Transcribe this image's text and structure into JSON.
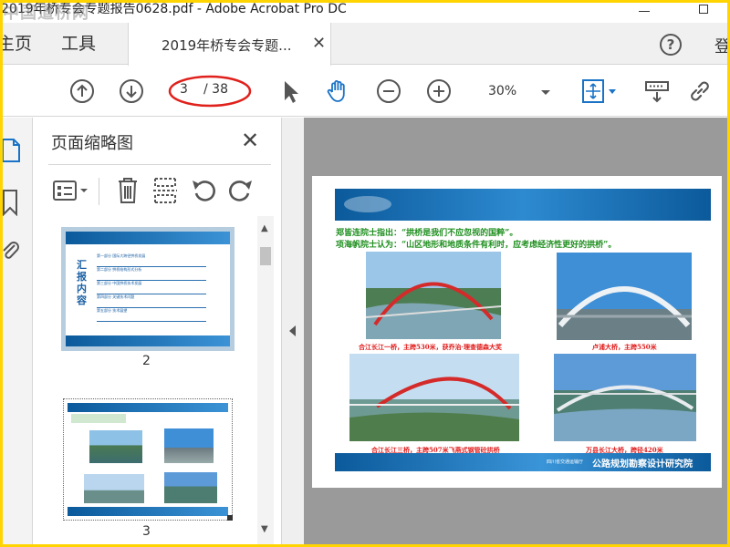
{
  "window": {
    "title": "2019年桥专会专题报告0628.pdf - Adobe Acrobat Pro DC",
    "watermark": "中国道桥网"
  },
  "tabs": {
    "home": "主页",
    "tools": "工具",
    "document": "2019年桥专会专题...",
    "login": "登"
  },
  "toolbar": {
    "current_page": "3",
    "total_pages": "/ 38",
    "zoom": "30%",
    "icons": [
      "prev-page-icon",
      "next-page-icon",
      "select-cursor-icon",
      "hand-tool-icon",
      "zoom-out-icon",
      "zoom-in-icon",
      "fit-page-icon",
      "read-mode-icon",
      "share-link-icon"
    ]
  },
  "thumb_panel": {
    "title": "页面缩略图",
    "thumbnails": [
      {
        "page_label": "2"
      },
      {
        "page_label": "3"
      }
    ]
  },
  "slide_p2": {
    "vertical_title": "汇报内容",
    "items": [
      "第一部分  国际大跨径拱桥发展",
      "第二部分  拱桥结构形式分析",
      "第三部分  中国拱桥技术发展",
      "第四部分  关键技术问题",
      "第五部分  技术展望"
    ]
  },
  "slide": {
    "quote1": "郑皆连院士指出：“拱桥是我们不应忽视的国粹”。",
    "quote2": "项海帆院士认为：“山区地形和地质条件有利时，应考虑经济性更好的拱桥”。",
    "captions": [
      "合江长江一桥，主跨530米，获乔治·理查德森大奖",
      "卢浦大桥，主跨550米",
      "合江长江三桥，主跨507米飞燕式钢管砼拱桥",
      "万县长江大桥，跨径420米"
    ],
    "footer_text": "公路规划勘察设计研究院",
    "logo_text": "四川省交通运输厅"
  },
  "colors": {
    "slide_blue": "#0b5a9b",
    "caption_red": "#e01b1b",
    "quote_green": "#1f8f1f",
    "highlight_border": "#e0201b"
  }
}
